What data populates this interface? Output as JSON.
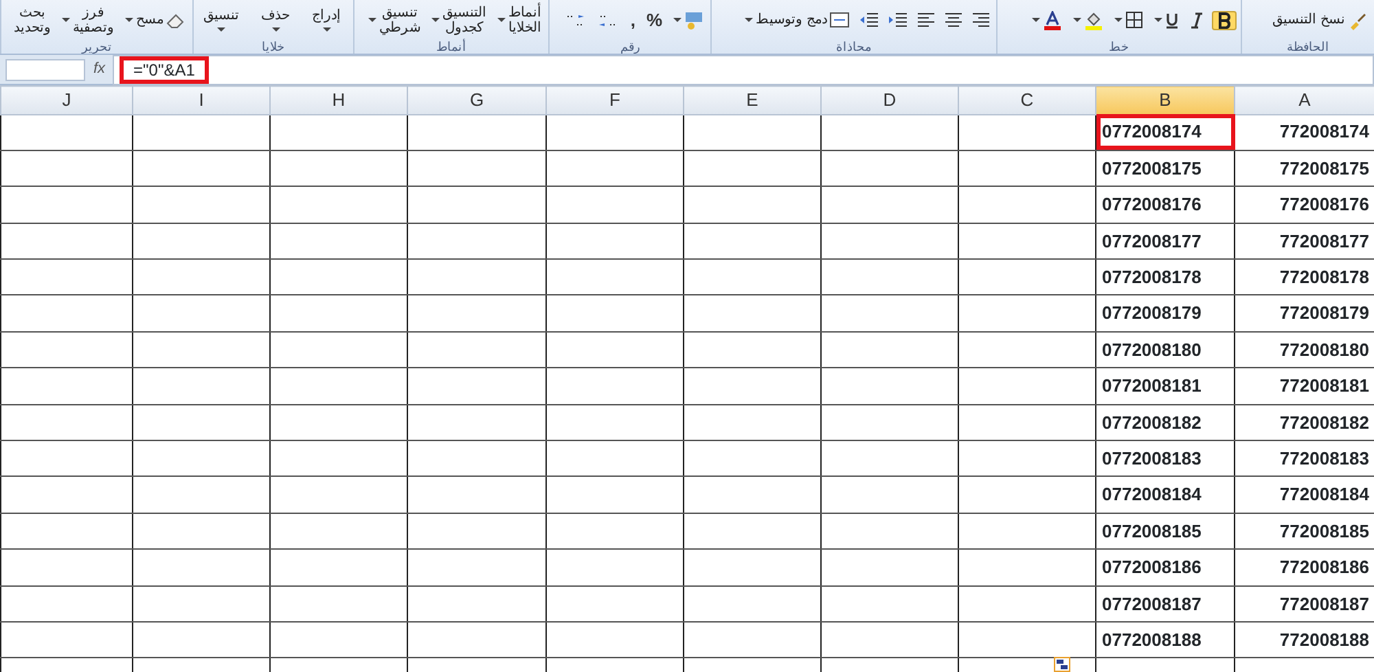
{
  "ribbon": {
    "groups": [
      {
        "label": "الحافظة",
        "items": [
          {
            "kind": "button",
            "lines": [
              "نسخ التنسيق"
            ],
            "dropdown": false
          }
        ]
      },
      {
        "label": "خط",
        "items": [
          {
            "kind": "icon",
            "selected": true
          },
          {
            "kind": "icon",
            "selected": false
          },
          {
            "kind": "icon",
            "selected": false,
            "dropdown": true
          },
          {
            "kind": "icon",
            "selected": false,
            "dropdown": true
          },
          {
            "kind": "icon",
            "selected": false,
            "dropdown": true
          },
          {
            "kind": "icon",
            "selected": false,
            "dropdown": true
          }
        ]
      },
      {
        "label": "محاذاة",
        "items": [
          {
            "kind": "icon",
            "selected": false
          },
          {
            "kind": "icon",
            "selected": false
          },
          {
            "kind": "icon",
            "selected": false
          },
          {
            "kind": "icon",
            "selected": false
          },
          {
            "kind": "icon",
            "selected": false
          },
          {
            "kind": "button",
            "lines": [
              "دمج وتوسيط"
            ],
            "dropdown": true
          }
        ]
      },
      {
        "label": "رقم",
        "items": [
          {
            "kind": "icon",
            "selected": false,
            "dropdown": true
          },
          {
            "kind": "glyph",
            "text": "%"
          },
          {
            "kind": "glyph",
            "text": ","
          },
          {
            "kind": "icon",
            "selected": false
          },
          {
            "kind": "icon",
            "selected": false
          }
        ]
      },
      {
        "label": "أنماط",
        "items": [
          {
            "kind": "button",
            "lines": [
              "أنماط",
              "الخلايا"
            ],
            "dropdown": true
          },
          {
            "kind": "button",
            "lines": [
              "التنسيق",
              "كجدول"
            ],
            "dropdown": true
          },
          {
            "kind": "button",
            "lines": [
              "تنسيق",
              "شرطي"
            ],
            "dropdown": true
          }
        ]
      },
      {
        "label": "خلايا",
        "items": [
          {
            "kind": "button",
            "lines": [
              "إدراج"
            ],
            "dropdown": true
          },
          {
            "kind": "button",
            "lines": [
              "حذف"
            ],
            "dropdown": true
          },
          {
            "kind": "button",
            "lines": [
              "تنسيق"
            ],
            "dropdown": true
          }
        ]
      },
      {
        "label": "تحرير",
        "items": [
          {
            "kind": "button",
            "lines": [
              "مسح"
            ],
            "dropdown": true
          },
          {
            "kind": "button",
            "lines": [
              "فرز",
              "وتصفية"
            ],
            "dropdown": true
          },
          {
            "kind": "button",
            "lines": [
              "بحث",
              "وتحديد"
            ],
            "dropdown": false
          }
        ]
      }
    ]
  },
  "formula_bar": {
    "fx": "fx",
    "formula": "=\"0\"&A1",
    "highlighted": true
  },
  "sheet": {
    "columns": [
      {
        "label": "A",
        "selected": false
      },
      {
        "label": "B",
        "selected": true
      },
      {
        "label": "C",
        "selected": false
      },
      {
        "label": "D",
        "selected": false
      },
      {
        "label": "E",
        "selected": false
      },
      {
        "label": "F",
        "selected": false
      },
      {
        "label": "G",
        "selected": false
      },
      {
        "label": "H",
        "selected": false
      },
      {
        "label": "I",
        "selected": false
      },
      {
        "label": "J",
        "selected": false
      }
    ],
    "rows": [
      {
        "A": "772008174",
        "B": "0772008174",
        "highlighted": true
      },
      {
        "A": "772008175",
        "B": "0772008175",
        "highlighted": false
      },
      {
        "A": "772008176",
        "B": "0772008176",
        "highlighted": false
      },
      {
        "A": "772008177",
        "B": "0772008177",
        "highlighted": false
      },
      {
        "A": "772008178",
        "B": "0772008178",
        "highlighted": false
      },
      {
        "A": "772008179",
        "B": "0772008179",
        "highlighted": false
      },
      {
        "A": "772008180",
        "B": "0772008180",
        "highlighted": false
      },
      {
        "A": "772008181",
        "B": "0772008181",
        "highlighted": false
      },
      {
        "A": "772008182",
        "B": "0772008182",
        "highlighted": false
      },
      {
        "A": "772008183",
        "B": "0772008183",
        "highlighted": false
      },
      {
        "A": "772008184",
        "B": "0772008184",
        "highlighted": false
      },
      {
        "A": "772008185",
        "B": "0772008185",
        "highlighted": false
      },
      {
        "A": "772008186",
        "B": "0772008186",
        "highlighted": false
      },
      {
        "A": "772008187",
        "B": "0772008187",
        "highlighted": false
      },
      {
        "A": "772008188",
        "B": "0772008188",
        "highlighted": false
      }
    ]
  }
}
